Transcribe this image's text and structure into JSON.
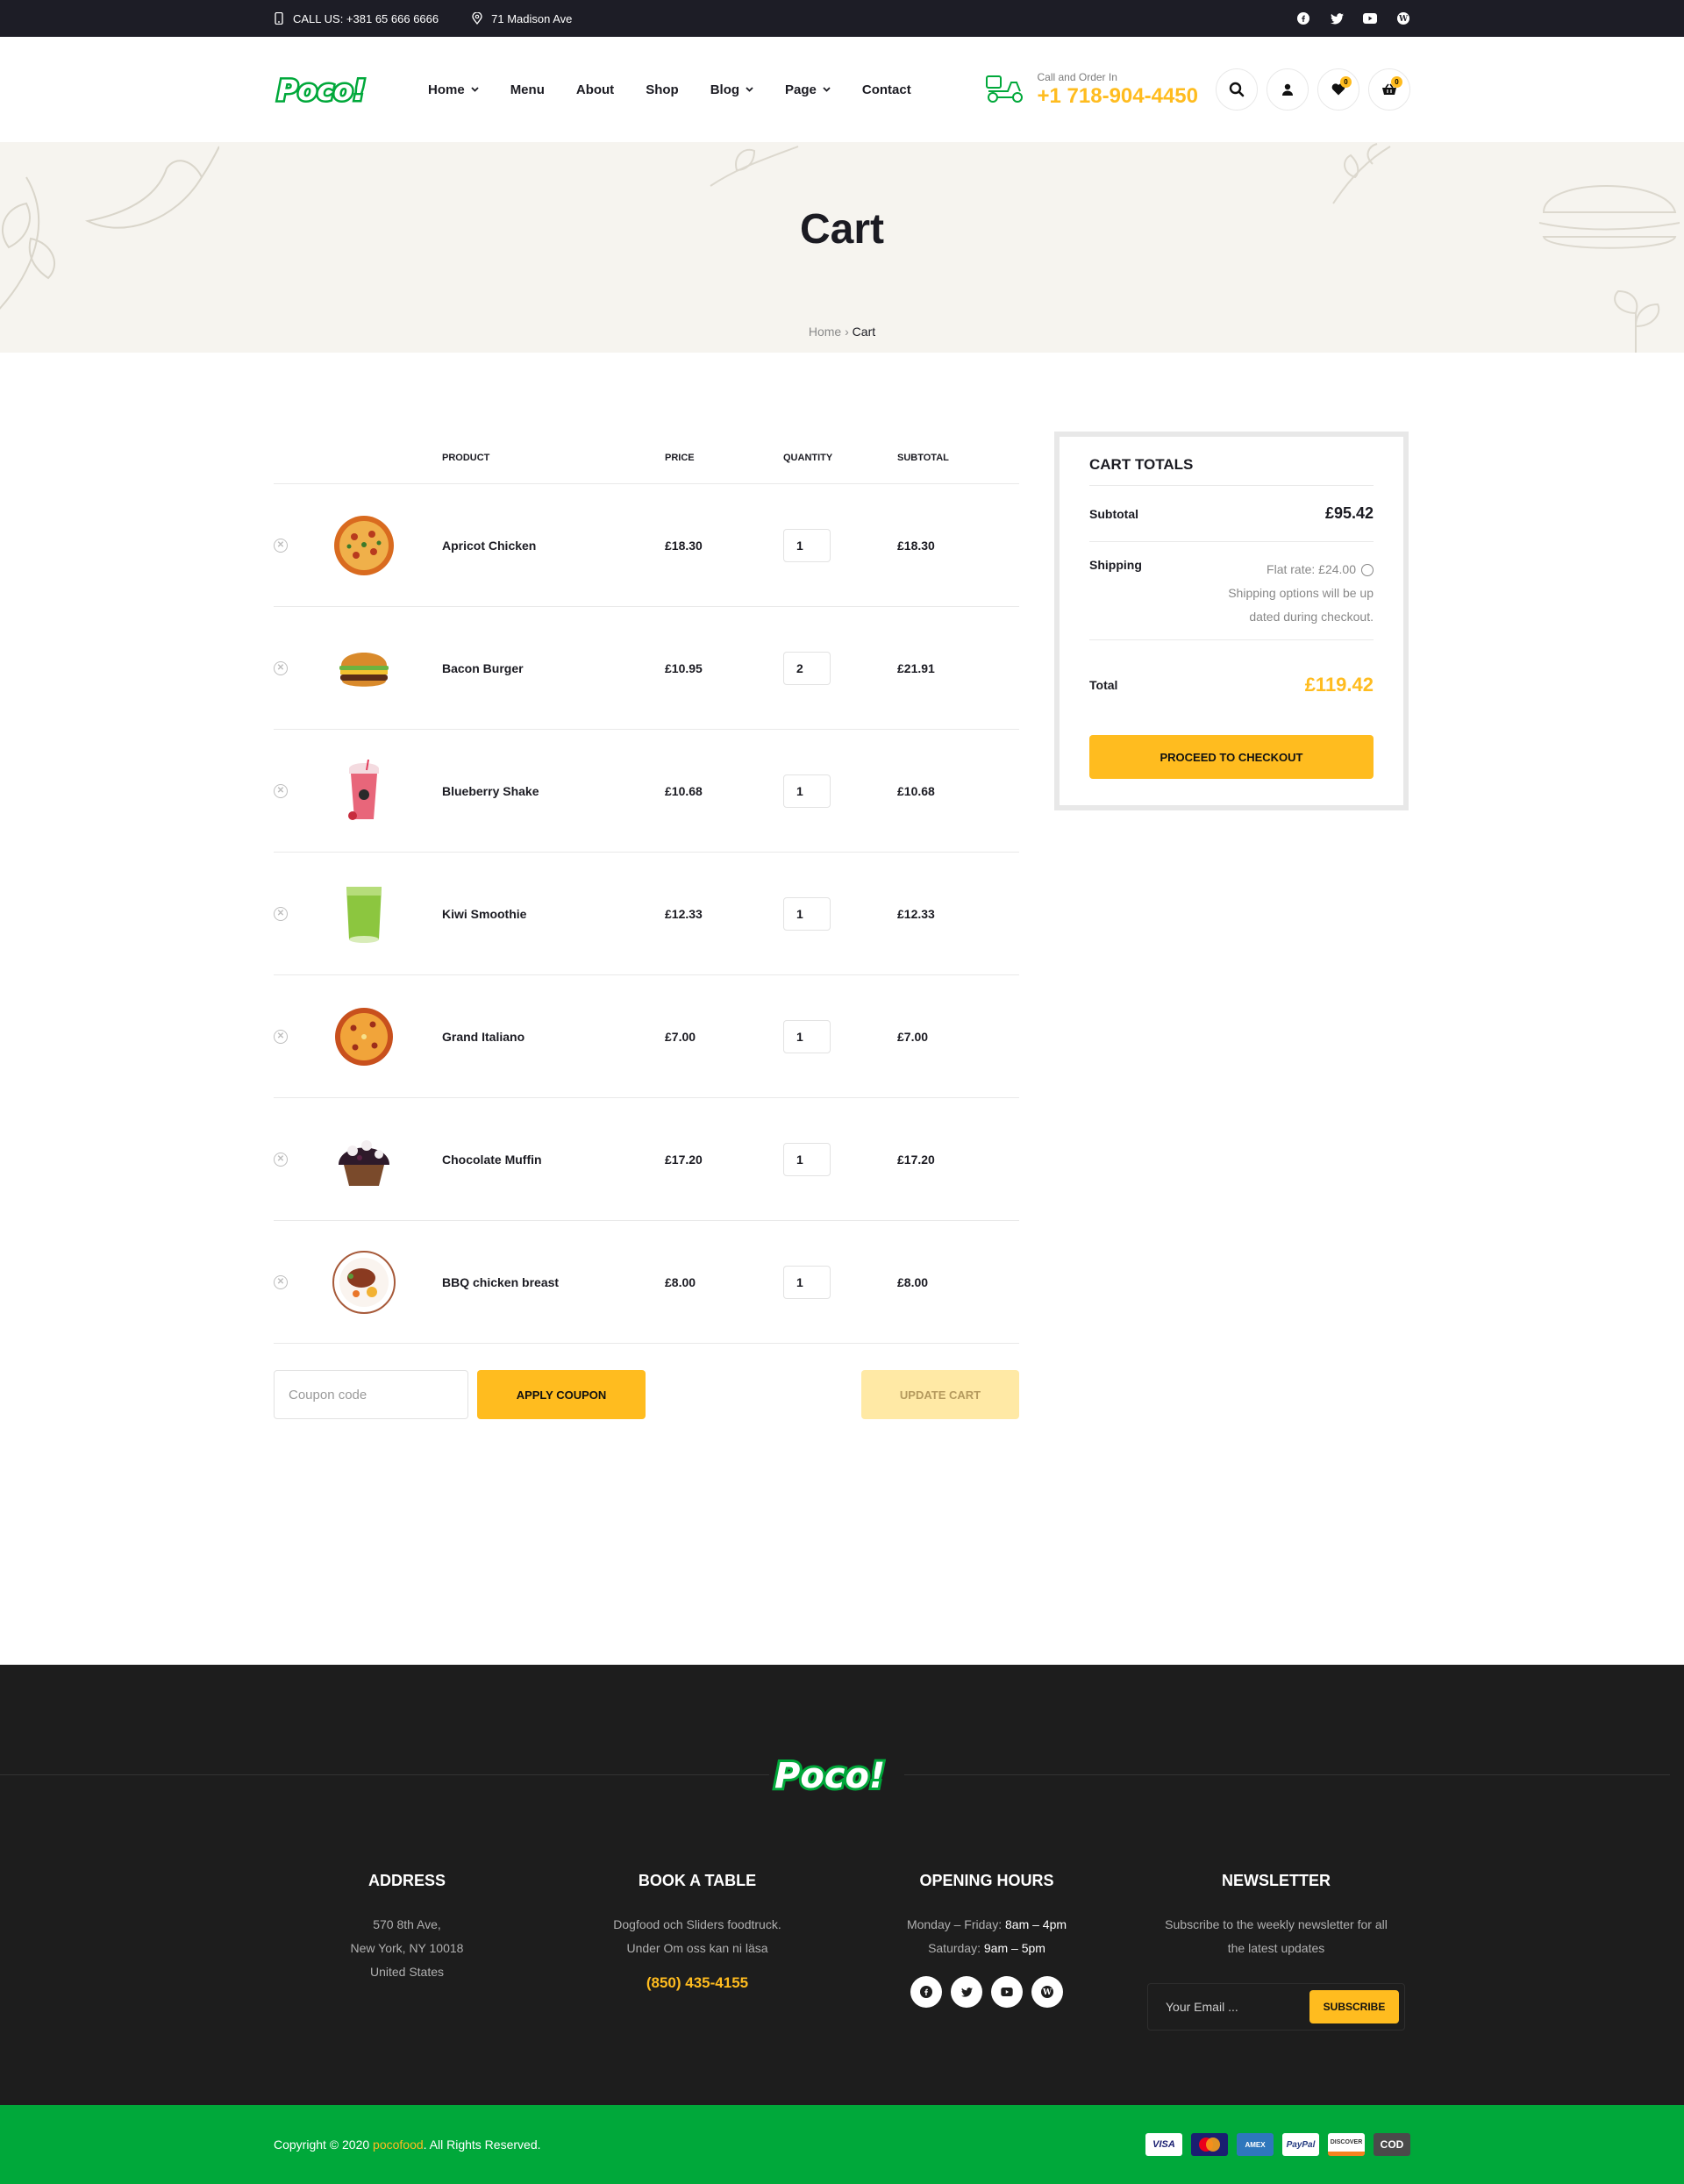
{
  "topbar": {
    "phone": "CALL US: +381 65 666 6666",
    "address": "71 Madison Ave"
  },
  "header": {
    "logo": "Poco!",
    "nav": [
      {
        "label": "Home",
        "dropdown": true
      },
      {
        "label": "Menu",
        "dropdown": false
      },
      {
        "label": "About",
        "dropdown": false
      },
      {
        "label": "Shop",
        "dropdown": false
      },
      {
        "label": "Blog",
        "dropdown": true
      },
      {
        "label": "Page",
        "dropdown": true
      },
      {
        "label": "Contact",
        "dropdown": false
      }
    ],
    "call_label": "Call and Order In",
    "call_number": "+1 718-904-4450",
    "wishlist_count": "0",
    "cart_count": "0"
  },
  "page": {
    "title": "Cart",
    "breadcrumb_home": "Home",
    "breadcrumb_sep": "›",
    "breadcrumb_current": "Cart"
  },
  "cart": {
    "headers": {
      "product": "PRODUCT",
      "price": "PRICE",
      "quantity": "QUANTITY",
      "subtotal": "SUBTOTAL"
    },
    "items": [
      {
        "name": "Apricot Chicken",
        "price": "£18.30",
        "qty": "1",
        "subtotal": "£18.30",
        "image": "pizza-image"
      },
      {
        "name": "Bacon Burger",
        "price": "£10.95",
        "qty": "2",
        "subtotal": "£21.91",
        "image": "burger-image"
      },
      {
        "name": "Blueberry Shake",
        "price": "£10.68",
        "qty": "1",
        "subtotal": "£10.68",
        "image": "shake-image"
      },
      {
        "name": "Kiwi Smoothie",
        "price": "£12.33",
        "qty": "1",
        "subtotal": "£12.33",
        "image": "smoothie-image"
      },
      {
        "name": "Grand Italiano",
        "price": "£7.00",
        "qty": "1",
        "subtotal": "£7.00",
        "image": "pizza-image"
      },
      {
        "name": "Chocolate Muffin",
        "price": "£17.20",
        "qty": "1",
        "subtotal": "£17.20",
        "image": "muffin-image"
      },
      {
        "name": "BBQ chicken breast",
        "price": "£8.00",
        "qty": "1",
        "subtotal": "£8.00",
        "image": "plate-image"
      }
    ],
    "coupon_placeholder": "Coupon code",
    "apply_label": "APPLY COUPON",
    "update_label": "UPDATE CART"
  },
  "totals": {
    "title": "CART TOTALS",
    "subtotal_label": "Subtotal",
    "subtotal_value": "£95.42",
    "shipping_label": "Shipping",
    "shipping_rate": "Flat rate: £24.00",
    "shipping_note_1": "Shipping options will be up",
    "shipping_note_2": "dated during checkout.",
    "total_label": "Total",
    "total_value": "£119.42",
    "checkout_label": "PROCEED TO CHECKOUT"
  },
  "footer": {
    "logo": "Poco!",
    "address": {
      "title": "ADDRESS",
      "line1": "570 8th Ave,",
      "line2": "New York, NY 10018",
      "line3": "United States"
    },
    "book": {
      "title": "BOOK A TABLE",
      "line1": "Dogfood och Sliders foodtruck.",
      "line2": "Under Om oss kan ni läsa",
      "phone": "(850) 435-4155"
    },
    "hours": {
      "title": "OPENING HOURS",
      "weekday_label": "Monday – Friday: ",
      "weekday_time": "8am – 4pm",
      "saturday_label": "Saturday: ",
      "saturday_time": "9am – 5pm"
    },
    "newsletter": {
      "title": "NEWSLETTER",
      "line1": "Subscribe to the weekly newsletter for all",
      "line2": "the latest updates",
      "placeholder": "Your Email ...",
      "button": "SUBSCRIBE"
    }
  },
  "bottom": {
    "copyright_prefix": "Copyright © 2020 ",
    "brand": "pocofood",
    "copyright_suffix": ". All Rights Reserved.",
    "payments": [
      "VISA",
      "MC",
      "AMEX",
      "PayPal",
      "DISCOVER",
      "COD"
    ]
  },
  "colors": {
    "accent": "#ffbc1f",
    "brand_green": "#00a83a",
    "dark": "#1d1d26"
  }
}
